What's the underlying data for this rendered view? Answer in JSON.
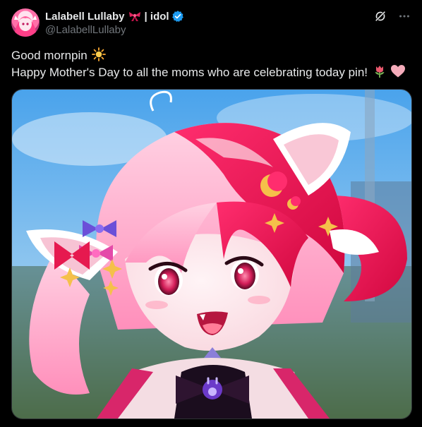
{
  "author": {
    "display_name": "Lalabell Lullaby",
    "name_suffix": "| idol",
    "handle": "@LalabellLullaby",
    "verified": true,
    "badge_color": "#1d9bf0"
  },
  "icons": {
    "ribbon": "ribbon-emoji",
    "verified": "verified-badge-icon",
    "grok": "grok-icon",
    "more": "more-horizontal-icon",
    "sun": "sun-emoji",
    "tulip": "tulip-emoji",
    "heart": "pink-heart-emoji"
  },
  "tweet": {
    "line1": "Good mornpin",
    "line2": "Happy Mother's Day to all the moms who are celebrating today pin!"
  },
  "colors": {
    "background": "#000000",
    "text": "#e7e9ea",
    "secondary": "#71767b",
    "border": "#2f3336"
  }
}
